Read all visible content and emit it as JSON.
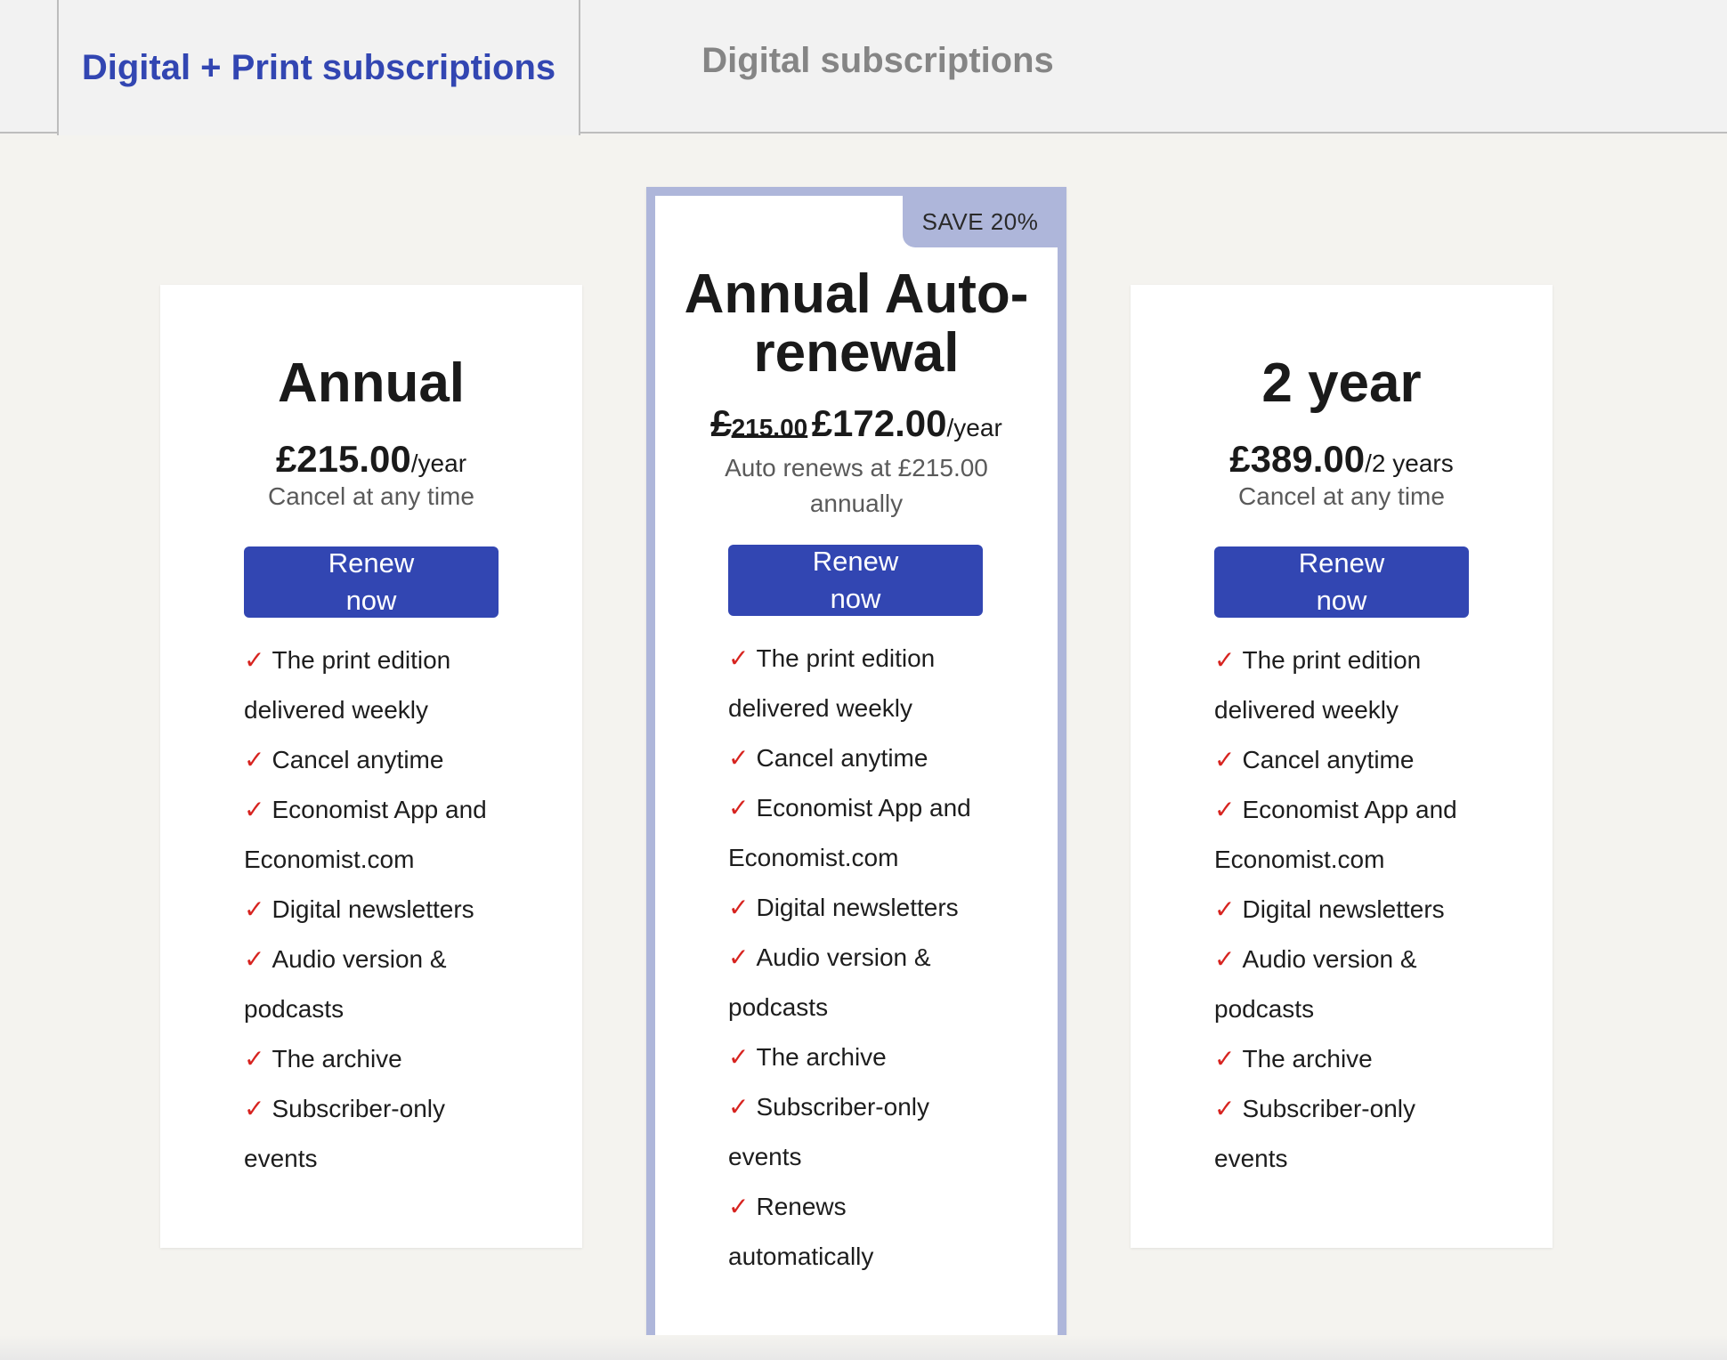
{
  "tabs": [
    {
      "label": "Digital + Print subscriptions",
      "active": true
    },
    {
      "label": "Digital subscriptions",
      "active": false
    }
  ],
  "plans": [
    {
      "title": "Annual",
      "price": "£215.00",
      "period": "/year",
      "note": "Cancel at any time",
      "button": "Renew now",
      "features": [
        "The print edition delivered weekly",
        "Cancel anytime",
        "Economist App and Economist.com",
        "Digital newsletters",
        "Audio version & podcasts",
        "The archive",
        "Subscriber-only events"
      ]
    },
    {
      "badge": "SAVE 20%",
      "title_line1": "Annual Auto-",
      "title_line2": "renewal",
      "old_price_main": "£",
      "old_price_small": "215.00",
      "price": "£172.00",
      "period": "/year",
      "note_line1": "Auto renews at £215.00",
      "note_line2": "annually",
      "button": "Renew now",
      "features": [
        "The print edition delivered weekly",
        "Cancel anytime",
        "Economist App and Economist.com",
        "Digital newsletters",
        "Audio version & podcasts",
        "The archive",
        "Subscriber-only events",
        "Renews automatically"
      ]
    },
    {
      "title": "2 year",
      "price": "£389.00",
      "period": "/2 years",
      "note": "Cancel at any time",
      "button": "Renew now",
      "features": [
        "The print edition delivered weekly",
        "Cancel anytime",
        "Economist App and Economist.com",
        "Digital newsletters",
        "Audio version & podcasts",
        "The archive",
        "Subscriber-only events"
      ]
    }
  ],
  "check_icon": "check-icon",
  "colors": {
    "accent": "#3246b2",
    "check": "#d7231f",
    "featured_border": "#aeb6da",
    "background": "#f4f3ef"
  }
}
